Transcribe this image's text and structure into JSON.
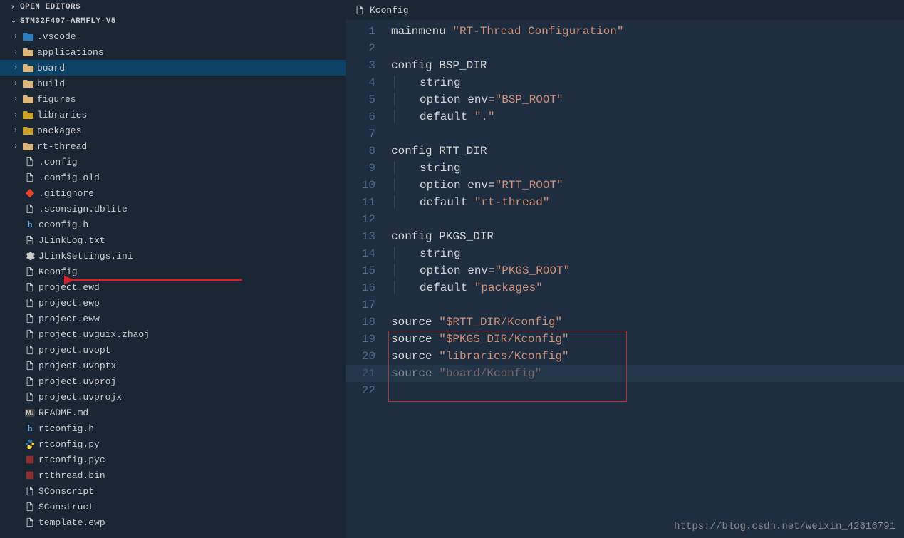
{
  "sidebar": {
    "open_editors_label": "OPEN EDITORS",
    "project_label": "STM32F407-ARMFLY-V5",
    "tree": [
      {
        "type": "folder",
        "label": ".vscode",
        "icon": "folder-vscode",
        "expandable": true
      },
      {
        "type": "folder",
        "label": "applications",
        "icon": "folder",
        "expandable": true
      },
      {
        "type": "folder",
        "label": "board",
        "icon": "folder-board",
        "expandable": true,
        "selected": true
      },
      {
        "type": "folder",
        "label": "build",
        "icon": "folder",
        "expandable": true
      },
      {
        "type": "folder",
        "label": "figures",
        "icon": "folder",
        "expandable": true
      },
      {
        "type": "folder",
        "label": "libraries",
        "icon": "folder-lib",
        "expandable": true
      },
      {
        "type": "folder",
        "label": "packages",
        "icon": "folder-pkg",
        "expandable": true
      },
      {
        "type": "folder",
        "label": "rt-thread",
        "icon": "folder",
        "expandable": true
      },
      {
        "type": "file",
        "label": ".config",
        "icon": "file"
      },
      {
        "type": "file",
        "label": ".config.old",
        "icon": "file"
      },
      {
        "type": "file",
        "label": ".gitignore",
        "icon": "git"
      },
      {
        "type": "file",
        "label": ".sconsign.dblite",
        "icon": "file"
      },
      {
        "type": "file",
        "label": "cconfig.h",
        "icon": "h"
      },
      {
        "type": "file",
        "label": "JLinkLog.txt",
        "icon": "txt"
      },
      {
        "type": "file",
        "label": "JLinkSettings.ini",
        "icon": "gear"
      },
      {
        "type": "file",
        "label": "Kconfig",
        "icon": "file",
        "arrow": true
      },
      {
        "type": "file",
        "label": "project.ewd",
        "icon": "file"
      },
      {
        "type": "file",
        "label": "project.ewp",
        "icon": "file"
      },
      {
        "type": "file",
        "label": "project.eww",
        "icon": "file"
      },
      {
        "type": "file",
        "label": "project.uvguix.zhaoj",
        "icon": "file"
      },
      {
        "type": "file",
        "label": "project.uvopt",
        "icon": "file"
      },
      {
        "type": "file",
        "label": "project.uvoptx",
        "icon": "file"
      },
      {
        "type": "file",
        "label": "project.uvproj",
        "icon": "file"
      },
      {
        "type": "file",
        "label": "project.uvprojx",
        "icon": "file"
      },
      {
        "type": "file",
        "label": "README.md",
        "icon": "md"
      },
      {
        "type": "file",
        "label": "rtconfig.h",
        "icon": "h"
      },
      {
        "type": "file",
        "label": "rtconfig.py",
        "icon": "py"
      },
      {
        "type": "file",
        "label": "rtconfig.pyc",
        "icon": "pyc"
      },
      {
        "type": "file",
        "label": "rtthread.bin",
        "icon": "bin"
      },
      {
        "type": "file",
        "label": "SConscript",
        "icon": "file"
      },
      {
        "type": "file",
        "label": "SConstruct",
        "icon": "file"
      },
      {
        "type": "file",
        "label": "template.ewp",
        "icon": "file"
      }
    ]
  },
  "editor": {
    "tab_label": "Kconfig",
    "lines": [
      {
        "n": "1",
        "content": [
          [
            "plain",
            "mainmenu "
          ],
          [
            "str",
            "\"RT-Thread Configuration\""
          ]
        ]
      },
      {
        "n": "2",
        "content": []
      },
      {
        "n": "3",
        "content": [
          [
            "plain",
            "config BSP_DIR"
          ]
        ]
      },
      {
        "n": "4",
        "content": [
          [
            "bar",
            "│   "
          ],
          [
            "plain",
            "string"
          ]
        ]
      },
      {
        "n": "5",
        "content": [
          [
            "bar",
            "│   "
          ],
          [
            "plain",
            "option env="
          ],
          [
            "str",
            "\"BSP_ROOT\""
          ]
        ]
      },
      {
        "n": "6",
        "content": [
          [
            "bar",
            "│   "
          ],
          [
            "plain",
            "default "
          ],
          [
            "str",
            "\".\""
          ]
        ]
      },
      {
        "n": "7",
        "content": []
      },
      {
        "n": "8",
        "content": [
          [
            "plain",
            "config RTT_DIR"
          ]
        ]
      },
      {
        "n": "9",
        "content": [
          [
            "bar",
            "│   "
          ],
          [
            "plain",
            "string"
          ]
        ]
      },
      {
        "n": "10",
        "content": [
          [
            "bar",
            "│   "
          ],
          [
            "plain",
            "option env="
          ],
          [
            "str",
            "\"RTT_ROOT\""
          ]
        ]
      },
      {
        "n": "11",
        "content": [
          [
            "bar",
            "│   "
          ],
          [
            "plain",
            "default "
          ],
          [
            "str",
            "\"rt-thread\""
          ]
        ]
      },
      {
        "n": "12",
        "content": []
      },
      {
        "n": "13",
        "content": [
          [
            "plain",
            "config PKGS_DIR"
          ]
        ]
      },
      {
        "n": "14",
        "content": [
          [
            "bar",
            "│   "
          ],
          [
            "plain",
            "string"
          ]
        ]
      },
      {
        "n": "15",
        "content": [
          [
            "bar",
            "│   "
          ],
          [
            "plain",
            "option env="
          ],
          [
            "str",
            "\"PKGS_ROOT\""
          ]
        ]
      },
      {
        "n": "16",
        "content": [
          [
            "bar",
            "│   "
          ],
          [
            "plain",
            "default "
          ],
          [
            "str",
            "\"packages\""
          ]
        ]
      },
      {
        "n": "17",
        "content": []
      },
      {
        "n": "18",
        "content": [
          [
            "plain",
            "source "
          ],
          [
            "str",
            "\"$RTT_DIR/Kconfig\""
          ]
        ]
      },
      {
        "n": "19",
        "content": [
          [
            "plain",
            "source "
          ],
          [
            "str",
            "\"$PKGS_DIR/Kconfig\""
          ]
        ]
      },
      {
        "n": "20",
        "content": [
          [
            "plain",
            "source "
          ],
          [
            "str",
            "\"libraries/Kconfig\""
          ]
        ]
      },
      {
        "n": "21",
        "content": [
          [
            "plain",
            "source "
          ],
          [
            "str",
            "\"board/Kconfig\""
          ]
        ]
      },
      {
        "n": "22",
        "content": []
      }
    ]
  },
  "watermark": "https://blog.csdn.net/weixin_42616791"
}
